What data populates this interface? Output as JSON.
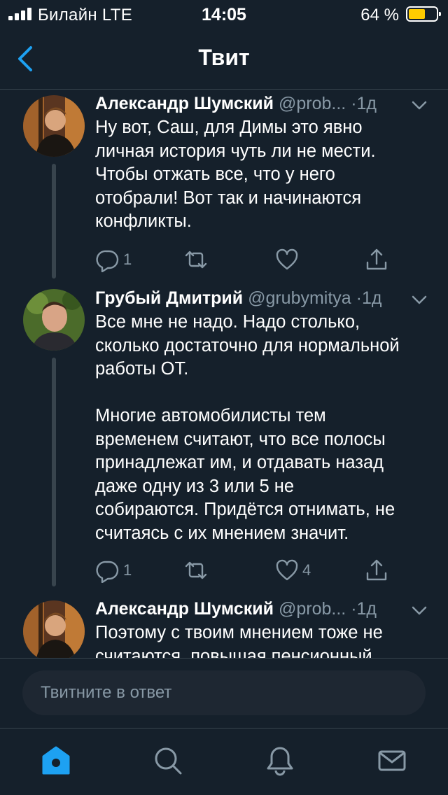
{
  "status_bar": {
    "carrier": "Билайн  LTE",
    "time": "14:05",
    "battery_percent": "64 %",
    "battery_level": 0.64
  },
  "nav": {
    "title": "Твит",
    "back_icon": "chevron-left-icon"
  },
  "tweets": [
    {
      "name": "Александр Шумский",
      "handle": "@prob...",
      "dot": "·",
      "time": "1д",
      "text": "Ну вот, Саш, для Димы это явно\nличная история чуть ли не мести.\nЧтобы отжать все, что у него\nотобрали! Вот так и начинаются\nконфликты.",
      "reply_count": "1",
      "retweet_count": "",
      "like_count": ""
    },
    {
      "name": "Грубый Дмитрий",
      "handle": "@grubymitya",
      "dot": "·",
      "time": "1д",
      "text": "Все мне не надо. Надо столько,\nсколько достаточно для нормальной\nработы ОТ.\n\nМногие автомобилисты тем\nвременем считают, что все полосы\nпринадлежат им, и отдавать назад\nдаже одну из 3 или 5 не\nсобираются. Придётся отнимать, не\nсчитаясь с их мнением значит.",
      "reply_count": "1",
      "retweet_count": "",
      "like_count": "4"
    },
    {
      "name": "Александр Шумский",
      "handle": "@prob...",
      "dot": "·",
      "time": "1д",
      "text": "Поэтому с твоим мнением тоже не\nсчитаются, повышая пенсионный"
    }
  ],
  "reply": {
    "placeholder": "Твитните в ответ"
  },
  "tabs": [
    "home-icon",
    "search-icon",
    "notifications-icon",
    "messages-icon"
  ],
  "colors": {
    "background": "#15202b",
    "accent": "#1da1f2",
    "secondary_text": "#8899a6",
    "battery": "#ffcc00"
  }
}
